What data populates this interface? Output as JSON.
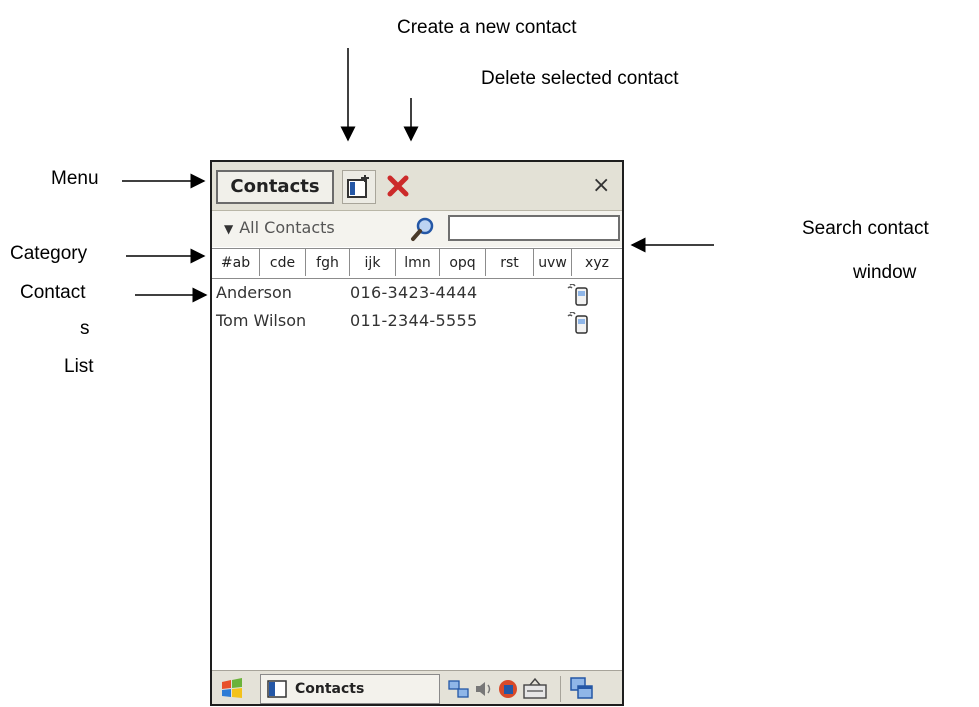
{
  "callouts": {
    "create": "Create a new contact",
    "delete": "Delete selected contact",
    "menu": "Menu",
    "category": "Category",
    "contacts_list_1": "Contact",
    "contacts_list_2": "s",
    "contacts_list_3": "List",
    "search_1": "Search contact",
    "search_2": "window"
  },
  "device": {
    "menu_label": "Contacts",
    "close_glyph": "×",
    "category": "All Contacts",
    "search_value": "",
    "alpha_tabs": [
      "#ab",
      "cde",
      "fgh",
      "ijk",
      "lmn",
      "opq",
      "rst",
      "uvw",
      "xyz"
    ],
    "contacts": [
      {
        "name": "Anderson",
        "phone": "016-3423-4444"
      },
      {
        "name": "Tom Wilson",
        "phone": "011-2344-5555"
      }
    ],
    "taskbar_label": "Contacts"
  },
  "icons": {
    "new_contact": "new-contact-icon",
    "delete": "delete-x-icon",
    "search": "search-magnifier-icon",
    "phone": "phone-icon",
    "start": "windows-flag-icon",
    "network": "network-icon",
    "volume": "speaker-icon",
    "input": "keyboard-icon",
    "desktop": "show-desktop-icon"
  },
  "colors": {
    "titlebar": "#e3e1d6",
    "delete_red": "#cc2a2a",
    "accent_blue": "#2457a6"
  }
}
